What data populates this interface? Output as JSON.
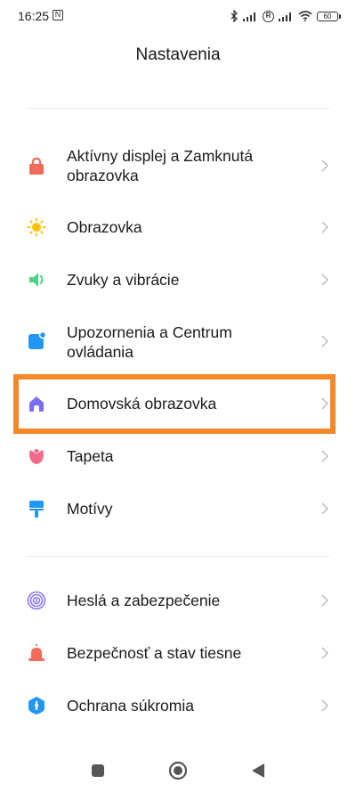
{
  "status_bar": {
    "time": "16:25",
    "nfc_glyph": "N",
    "roaming_glyph": "R",
    "battery_level": "60",
    "icons": [
      "nfc-icon",
      "bluetooth-icon",
      "signal-icon",
      "roaming-icon",
      "signal-icon",
      "wifi-icon",
      "battery-icon"
    ]
  },
  "header": {
    "title": "Nastavenia"
  },
  "groups": [
    {
      "items": [
        {
          "label": "Aktívny displej a Zamknutá obrazovka",
          "icon": "lock-icon",
          "color": "#f26b5b"
        },
        {
          "label": "Obrazovka",
          "icon": "brightness-icon",
          "color": "#ffc107"
        },
        {
          "label": "Zvuky a vibrácie",
          "icon": "speaker-icon",
          "color": "#4cd18a"
        },
        {
          "label": "Upozornenia a Centrum ovládania",
          "icon": "notification-icon",
          "color": "#2196f3"
        },
        {
          "label": "Domovská obrazovka",
          "icon": "home-icon",
          "color": "#7b6cf6",
          "highlighted": true
        },
        {
          "label": "Tapeta",
          "icon": "tulip-icon",
          "color": "#f06b8a"
        },
        {
          "label": "Motívy",
          "icon": "paint-roller-icon",
          "color": "#2196f3"
        }
      ]
    },
    {
      "items": [
        {
          "label": "Heslá a zabezpečenie",
          "icon": "fingerprint-icon",
          "color": "#8a78f0"
        },
        {
          "label": "Bezpečnosť a stav tiesne",
          "icon": "alarm-icon",
          "color": "#f26b5b"
        },
        {
          "label": "Ochrana súkromia",
          "icon": "privacy-shield-icon",
          "color": "#2196f3"
        }
      ]
    }
  ],
  "highlight_color": "#f5892a",
  "nav_bar": {
    "buttons": [
      "recents-icon",
      "home-circle-icon",
      "back-icon"
    ]
  }
}
